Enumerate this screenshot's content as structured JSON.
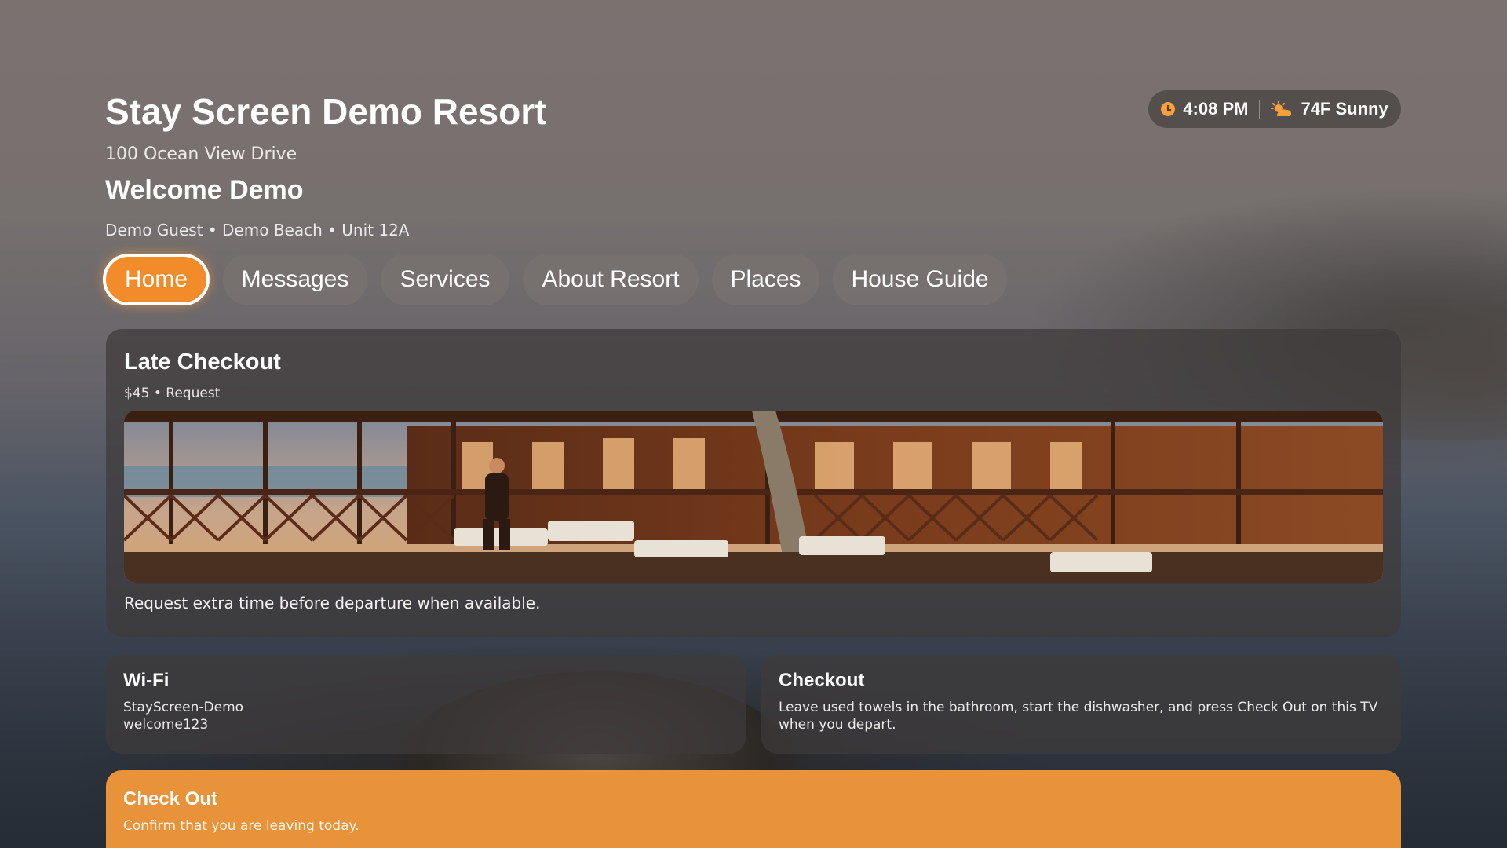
{
  "header": {
    "resort_name": "Stay Screen Demo Resort",
    "address": "100 Ocean View Drive",
    "welcome": "Welcome Demo",
    "guest_line": "Demo Guest • Demo Beach • Unit 12A"
  },
  "status": {
    "time": "4:08 PM",
    "weather": "74F Sunny",
    "icons": [
      "clock-icon",
      "partly-sunny-icon"
    ]
  },
  "tabs": [
    {
      "label": "Home",
      "active": true
    },
    {
      "label": "Messages",
      "active": false
    },
    {
      "label": "Services",
      "active": false
    },
    {
      "label": "About Resort",
      "active": false
    },
    {
      "label": "Places",
      "active": false
    },
    {
      "label": "House Guide",
      "active": false
    }
  ],
  "featured": {
    "title": "Late Checkout",
    "subtitle": "$45 • Request",
    "description": "Request extra time before departure when available."
  },
  "wifi": {
    "title": "Wi-Fi",
    "network": "StayScreen-Demo",
    "password": "welcome123"
  },
  "checkout_info": {
    "title": "Checkout",
    "text": "Leave used towels in the bathroom, start the dishwasher, and press Check Out on this TV when you depart."
  },
  "checkout_button": {
    "title": "Check Out",
    "subtitle": "Confirm that you are leaving today."
  },
  "colors": {
    "accent": "#f28c2a",
    "checkout_button": "#e8923a",
    "card_bg": "#3e3a3a"
  }
}
